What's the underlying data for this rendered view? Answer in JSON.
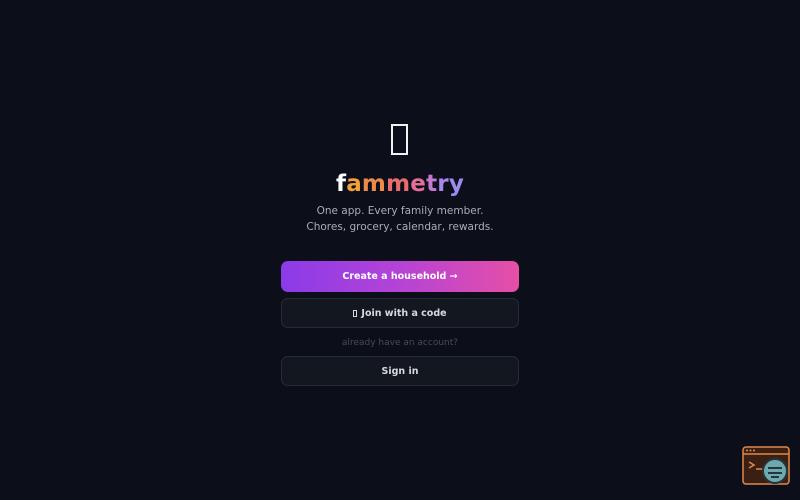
{
  "brand": {
    "letters": [
      "f",
      "a",
      "m",
      "m",
      "e",
      "t",
      "r",
      "y"
    ],
    "letter_colors": [
      "#ffffff",
      "#f2a03a",
      "#ee8a45",
      "#ea6d6e",
      "#e56d9a",
      "#c677cf",
      "#a787ea",
      "#9b8df0"
    ],
    "logo_icon": "app-logo-glyph"
  },
  "tagline": {
    "line1": "One app. Every family member.",
    "line2": "Chores, grocery, calendar, rewards."
  },
  "actions": {
    "create_label": "Create a household →",
    "join_label": "Join with a code",
    "join_icon": "key-icon",
    "account_hint": "already have an account?",
    "signin_label": "Sign in"
  },
  "colors": {
    "background": "#0c0f1a",
    "primary_gradient_start": "#8a3be8",
    "primary_gradient_end": "#e64fa6",
    "secondary_bg": "#131820",
    "muted_text": "#454b55"
  }
}
